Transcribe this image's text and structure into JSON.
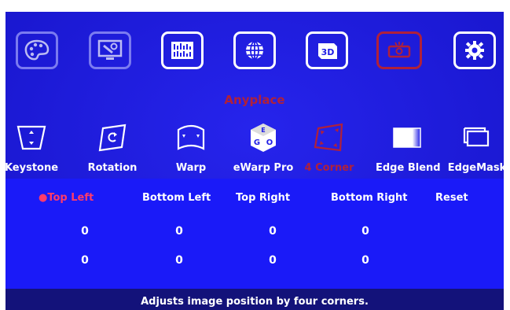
{
  "menu": {
    "categories": [
      {
        "icon": "palette-icon",
        "state": "dim"
      },
      {
        "icon": "monitor-settings-icon",
        "state": "dim"
      },
      {
        "icon": "adjust-bars-icon",
        "state": "normal"
      },
      {
        "icon": "globe-icon",
        "state": "normal"
      },
      {
        "icon": "3d-cube-icon",
        "state": "normal"
      },
      {
        "icon": "projector-icon",
        "state": "selected"
      },
      {
        "icon": "gear-icon",
        "state": "normal"
      }
    ],
    "selected_category_label": "Anyplace",
    "functions": [
      {
        "label": "Keystone",
        "icon": "keystone-icon",
        "selected": false
      },
      {
        "label": "Rotation",
        "icon": "rotation-icon",
        "selected": false
      },
      {
        "label": "Warp",
        "icon": "warp-icon",
        "selected": false
      },
      {
        "label": "eWarp Pro",
        "icon": "ewarp-icon",
        "selected": false
      },
      {
        "label": "4 Corner",
        "icon": "four-corner-icon",
        "selected": true
      },
      {
        "label": "Edge Blend",
        "icon": "edge-blend-icon",
        "selected": false
      },
      {
        "label": "EdgeMask",
        "icon": "edge-mask-icon",
        "selected": false
      }
    ]
  },
  "corners": {
    "headers": [
      "●Top Left",
      "Bottom Left",
      "Top Right",
      "Bottom Right",
      "Reset"
    ],
    "rows": [
      [
        "0",
        "0",
        "0",
        "0"
      ],
      [
        "0",
        "0",
        "0",
        "0"
      ]
    ]
  },
  "help_text": "Adjusts image position by four corners.",
  "colors": {
    "background": "#1f1ce6",
    "selected": "#b0213a",
    "active_item": "#ff3b6b",
    "text": "#ffffff"
  }
}
